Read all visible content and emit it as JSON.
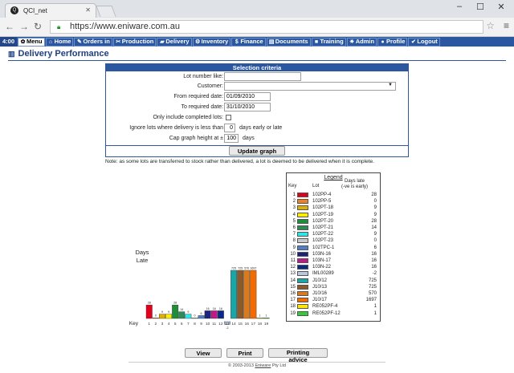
{
  "browser": {
    "tab_title": "QCI_net",
    "tab_favicon": "Q",
    "url": "https://www.eniware.com.au",
    "min": "–",
    "max": "☐",
    "close": "✕"
  },
  "appbar": {
    "time": "4:00",
    "items": [
      {
        "label": "Menu",
        "icon": "✿"
      },
      {
        "label": "Home",
        "icon": "⌂"
      },
      {
        "label": "Orders in",
        "icon": "✎"
      },
      {
        "label": "Production",
        "icon": "✂"
      },
      {
        "label": "Delivery",
        "icon": "▰"
      },
      {
        "label": "Inventory",
        "icon": "⚙"
      },
      {
        "label": "Finance",
        "icon": "$"
      },
      {
        "label": "Documents",
        "icon": "▤"
      },
      {
        "label": "Training",
        "icon": "■"
      },
      {
        "label": "Admin",
        "icon": "✷"
      },
      {
        "label": "Profile",
        "icon": "●"
      },
      {
        "label": "Logout",
        "icon": "✔"
      }
    ]
  },
  "page": {
    "title": "Delivery Performance",
    "title_icon": "bar-chart-icon"
  },
  "criteria": {
    "heading": "Selection criteria",
    "lot_label": "Lot number like:",
    "lot_value": "",
    "customer_label": "Customer:",
    "customer_value": "",
    "from_label": "From required date:",
    "from_value": "01/09/2010",
    "to_label": "To required date:",
    "to_value": "31/10/2010",
    "completed_label": "Only include completed lots:",
    "ignore_label": "Ignore lots where delivery is less than",
    "ignore_value": "0",
    "ignore_after": "days early or late",
    "cap_label": "Cap graph height at ±",
    "cap_value": "100",
    "cap_after": "days",
    "update_button": "Update graph"
  },
  "note": "Note: as some lots are transferred to stock rather than delivered, a lot is deemed to be delivered when it is complete.",
  "chart": {
    "ylabel_line1": "Days",
    "ylabel_line2": "Late",
    "key_label": "Key",
    "cap": 100
  },
  "chart_data": {
    "type": "bar",
    "ylabel": "Days Late",
    "categories": [
      "1",
      "2",
      "3",
      "4",
      "5",
      "6",
      "7",
      "8",
      "9",
      "10",
      "11",
      "12",
      "13",
      "14",
      "15",
      "16",
      "17",
      "18",
      "19"
    ],
    "values": [
      28,
      0,
      9,
      9,
      28,
      14,
      9,
      0,
      6,
      16,
      16,
      16,
      -2,
      725,
      725,
      570,
      1697,
      1,
      1
    ],
    "colors": [
      "#e3001b",
      "#f07f1f",
      "#e0b000",
      "#ffee00",
      "#1f8e3a",
      "#2e8b57",
      "#2ee6e6",
      "#c8c8c8",
      "#4f7fc7",
      "#1a237e",
      "#c2188a",
      "#0a2a8a",
      "#b8c8e0",
      "#1aa6a6",
      "#8b5a2b",
      "#d97a1f",
      "#f26a00",
      "#ffe600",
      "#33cc33"
    ],
    "ylim": [
      -100,
      100
    ]
  },
  "legend": {
    "title": "Legend",
    "col_key": "Key",
    "col_lot": "Lot",
    "col_days": "Days late",
    "col_days2": "(-ve is early)",
    "rows": [
      {
        "key": "1",
        "lot": "102PP-4",
        "days": "28"
      },
      {
        "key": "2",
        "lot": "102PP-5",
        "days": "0"
      },
      {
        "key": "3",
        "lot": "102PT-18",
        "days": "9"
      },
      {
        "key": "4",
        "lot": "102PT-19",
        "days": "9"
      },
      {
        "key": "5",
        "lot": "102PT-20",
        "days": "28"
      },
      {
        "key": "6",
        "lot": "102PT-21",
        "days": "14"
      },
      {
        "key": "7",
        "lot": "102PT-22",
        "days": "9"
      },
      {
        "key": "8",
        "lot": "102PT-23",
        "days": "0"
      },
      {
        "key": "9",
        "lot": "102TPC-1",
        "days": "6"
      },
      {
        "key": "10",
        "lot": "103N-16",
        "days": "16"
      },
      {
        "key": "11",
        "lot": "103N-17",
        "days": "16"
      },
      {
        "key": "12",
        "lot": "103N-22",
        "days": "16"
      },
      {
        "key": "13",
        "lot": "IML00289",
        "days": "-2"
      },
      {
        "key": "14",
        "lot": "J10/12",
        "days": "725"
      },
      {
        "key": "15",
        "lot": "J10/13",
        "days": "725"
      },
      {
        "key": "16",
        "lot": "J10/16",
        "days": "570"
      },
      {
        "key": "17",
        "lot": "J10/17",
        "days": "1697"
      },
      {
        "key": "18",
        "lot": "RE052PF-4",
        "days": "1"
      },
      {
        "key": "19",
        "lot": "RE052PF-12",
        "days": "1"
      }
    ]
  },
  "actions": {
    "view": "View",
    "print": "Print",
    "printing_advice": "Printing advice"
  },
  "footer": {
    "text_prefix": "© 2003-2013 ",
    "brand": "Eniware",
    "text_suffix": " Pty Ltd"
  }
}
